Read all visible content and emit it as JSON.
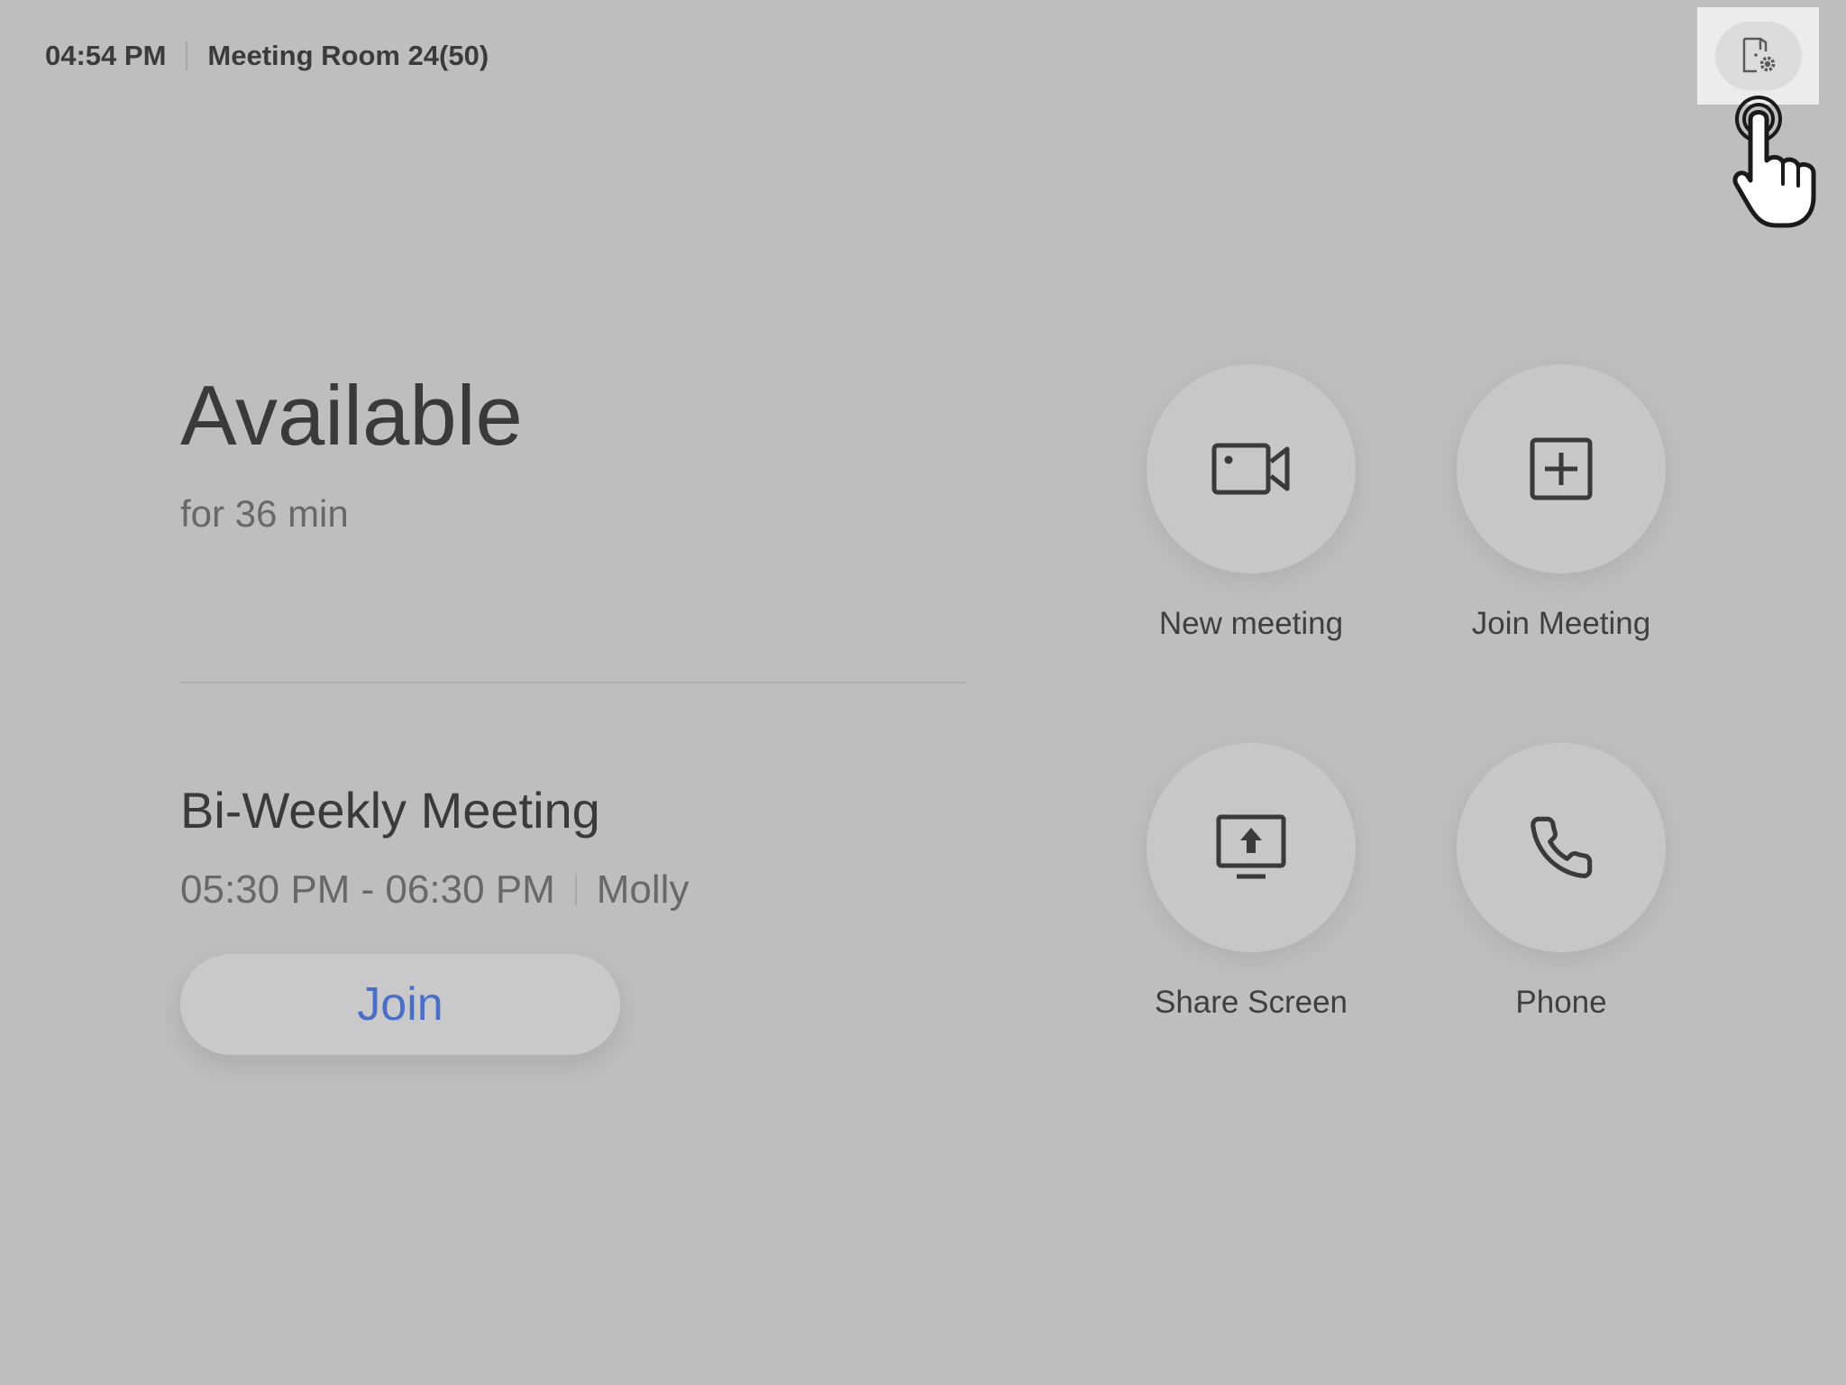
{
  "header": {
    "time": "04:54 PM",
    "room_name": "Meeting Room 24(50)",
    "settings_icon": "room-settings-icon"
  },
  "status": {
    "title": "Available",
    "subtitle": "for 36 min"
  },
  "upcoming_meeting": {
    "title": "Bi-Weekly Meeting",
    "time_range": "05:30 PM - 06:30 PM",
    "organizer": "Molly",
    "join_label": "Join"
  },
  "actions": [
    {
      "label": "New meeting",
      "icon": "video-camera-icon"
    },
    {
      "label": "Join Meeting",
      "icon": "plus-square-icon"
    },
    {
      "label": "Share Screen",
      "icon": "share-screen-icon"
    },
    {
      "label": "Phone",
      "icon": "phone-icon"
    }
  ],
  "colors": {
    "background": "#bebec0",
    "join_text": "#4a6fc7"
  }
}
